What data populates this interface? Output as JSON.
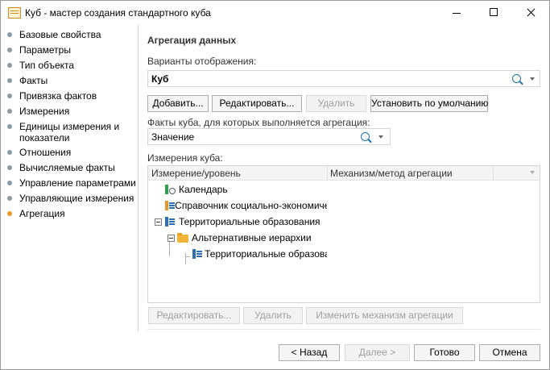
{
  "window": {
    "title": "Куб - мастер создания стандартного куба"
  },
  "sidebar": {
    "items": [
      {
        "label": "Базовые свойства",
        "active": false
      },
      {
        "label": "Параметры",
        "active": false
      },
      {
        "label": "Тип объекта",
        "active": false
      },
      {
        "label": "Факты",
        "active": false
      },
      {
        "label": "Привязка фактов",
        "active": false
      },
      {
        "label": "Измерения",
        "active": false
      },
      {
        "label": "Единицы измерения и",
        "label2": "показатели",
        "active": false
      },
      {
        "label": "Отношения",
        "active": false
      },
      {
        "label": "Вычисляемые факты",
        "active": false
      },
      {
        "label": "Управление параметрами",
        "active": false
      },
      {
        "label": "Управляющие измерения",
        "active": false
      },
      {
        "label": "Агрегация",
        "active": true
      }
    ]
  },
  "main": {
    "section_title": "Агрегация данных",
    "variants_label": "Варианты отображения:",
    "variants_value": "Куб",
    "buttons": {
      "add": "Добавить...",
      "edit": "Редактировать...",
      "delete": "Удалить",
      "set_default": "Установить по умолчанию"
    },
    "facts_label": "Факты куба, для которых выполняется агрегация:",
    "facts_value": "Значение",
    "dims_label": "Измерения куба:",
    "grid": {
      "col1": "Измерение/уровень",
      "col2": "Механизм/метод агрегации",
      "rows": [
        {
          "label": "Календарь"
        },
        {
          "label": "Справочник социально-экономических показателей"
        },
        {
          "label": "Территориальные образования"
        },
        {
          "label": "Альтернативные иерархии"
        },
        {
          "label": "Территориальные образования"
        }
      ]
    },
    "bottom_buttons": {
      "edit": "Редактировать...",
      "delete": "Удалить",
      "change": "Изменить механизм агрегации"
    }
  },
  "footer": {
    "back": "< Назад",
    "next": "Далее >",
    "finish": "Готово",
    "cancel": "Отмена"
  },
  "colors": {
    "accent": "#e8952a",
    "icon_blue": "#2d6fb4",
    "bullet": "#8c9aa8"
  }
}
